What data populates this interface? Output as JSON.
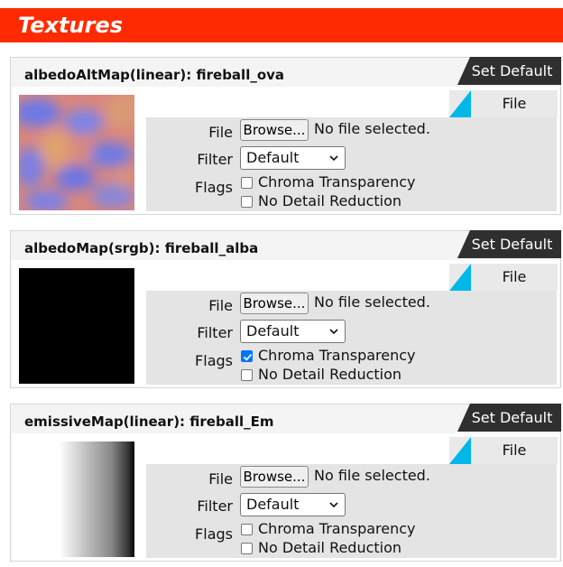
{
  "header": {
    "title": "Textures"
  },
  "common": {
    "set_default_label": "Set Default",
    "file_tab_label": "File",
    "file_label": "File",
    "browse_label": "Browse...",
    "no_file_label": "No file selected.",
    "filter_label": "Filter",
    "flags_label": "Flags",
    "chroma_label": "Chroma Transparency",
    "nodetail_label": "No Detail Reduction"
  },
  "colors": {
    "header_bg": "#ff2b00",
    "accent": "#00b7ea",
    "dark_button": "#2f2f2f",
    "checkbox_checked": "#0075ff"
  },
  "panels": [
    {
      "title": "albedoAltMap(linear): fireball_ova",
      "thumbnail": "blue-orange plasma texture",
      "filter": "Default",
      "chroma_checked": false,
      "nodetail_checked": false
    },
    {
      "title": "albedoMap(srgb): fireball_alba",
      "thumbnail": "solid black texture",
      "filter": "Default",
      "chroma_checked": true,
      "nodetail_checked": false
    },
    {
      "title": "emissiveMap(linear): fireball_Em",
      "thumbnail": "white-to-black horizontal gradient",
      "filter": "Default",
      "chroma_checked": false,
      "nodetail_checked": false
    }
  ]
}
